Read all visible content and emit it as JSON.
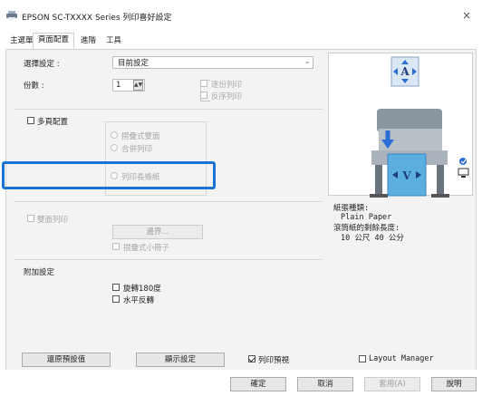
{
  "window": {
    "title": "EPSON  SC-TXXXX Series 列印喜好設定",
    "close_glyph": "×"
  },
  "tabs": [
    {
      "label": "主選單",
      "active": false
    },
    {
      "label": "頁面配置",
      "active": true
    },
    {
      "label": "進階",
      "active": false
    },
    {
      "label": "工具",
      "active": false
    }
  ],
  "select_setting": {
    "label": "選擇設定 :",
    "value": "目前設定"
  },
  "copies": {
    "label": "份數 :",
    "value": "1",
    "collate_label": "逐份列印",
    "reverse_label": "反序列印"
  },
  "multipage": {
    "label": "多頁配置",
    "options": [
      "摺疊式雙面",
      "合併列印",
      "列印長條紙"
    ]
  },
  "duplex": {
    "label": "雙面列印",
    "margins_button": "邊界...",
    "booklet_label": "摺疊式小冊子"
  },
  "additional": {
    "title": "附加設定",
    "rotate_label": "旋轉180度",
    "mirror_label": "水平反轉"
  },
  "preview_info": {
    "paper_type_label": "紙張種類:",
    "paper_type_value": "Plain Paper",
    "remaining_label": "滾筒紙的剩餘長度:",
    "remaining_value": "10 公尺 40 公分"
  },
  "footer": {
    "restore_button": "還原預設值",
    "show_settings_button": "顯示設定",
    "print_preview_label": "列印預視",
    "print_preview_checked": true,
    "layout_manager_label": "Layout Manager",
    "layout_manager_checked": false
  },
  "dialog_buttons": {
    "ok": "確定",
    "cancel": "取消",
    "apply": "套用(A)",
    "help": "說明"
  },
  "colors": {
    "highlight": "#1a72d4",
    "printer_arrow": "#2b6fd6",
    "paper_blue": "#5aaee0"
  }
}
